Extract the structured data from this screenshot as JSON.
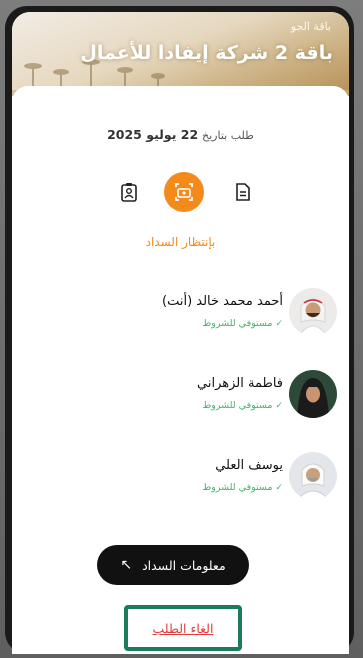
{
  "header": {
    "subtitle": "باقة الجو",
    "title": "باقة 2 شركة إيفادا للأعمال"
  },
  "order": {
    "date_label": "طلب بتاريخ",
    "date_value": "22 يوليو 2025"
  },
  "steps": {
    "icons": [
      "id-card-icon",
      "payment-scan-icon",
      "document-icon"
    ],
    "active_index": 1,
    "status": "بإنتظار السداد"
  },
  "members": [
    {
      "name": "أحمد محمد خالد (أنت)",
      "status": "مستوفي للشروط"
    },
    {
      "name": "فاطمة الزهراني",
      "status": "مستوفي للشروط"
    },
    {
      "name": "يوسف العلي",
      "status": "مستوفي للشروط"
    }
  ],
  "actions": {
    "payment_info_label": "معلومات السداد",
    "cancel_label": "الغاء الطلب"
  },
  "colors": {
    "accent": "#f38a1a",
    "success": "#4caf6b",
    "danger": "#e23b3b",
    "highlight": "#1a7d5a",
    "button": "#111111"
  }
}
